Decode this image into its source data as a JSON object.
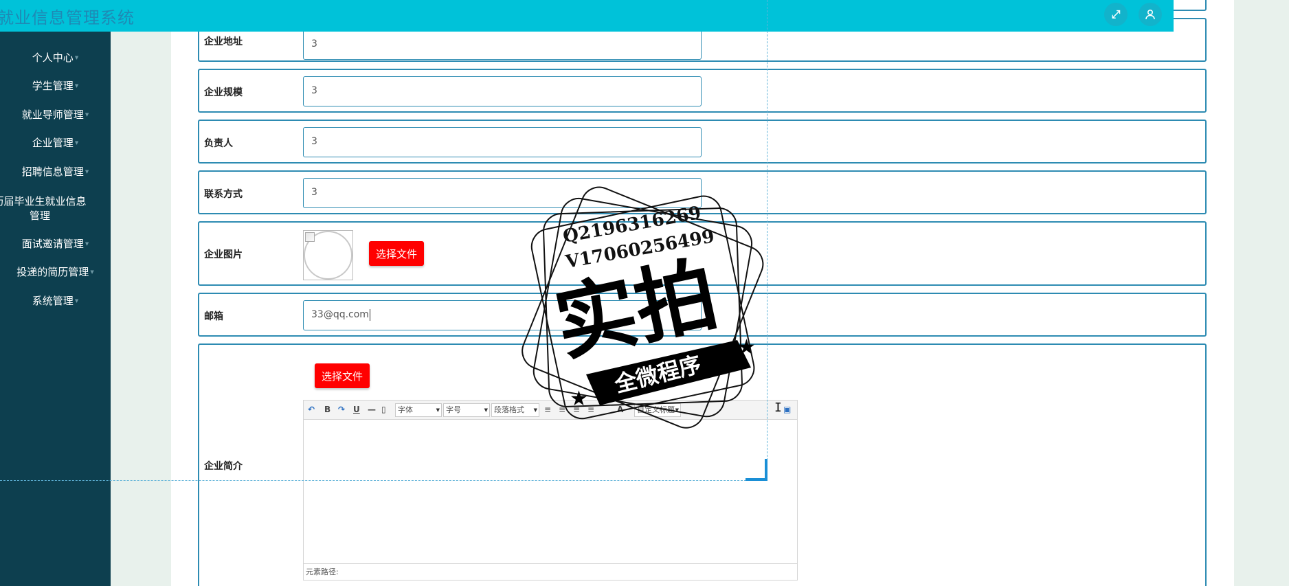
{
  "header": {
    "title": "就业信息管理系统",
    "fullscreen_icon": "expand-icon",
    "user_icon": "user-icon"
  },
  "sidebar": {
    "items": [
      {
        "label": "个人中心"
      },
      {
        "label": "学生管理"
      },
      {
        "label": "就业导师管理"
      },
      {
        "label": "企业管理"
      },
      {
        "label": "招聘信息管理"
      },
      {
        "label": "历届毕业生就业信息管理"
      },
      {
        "label": "面试邀请管理"
      },
      {
        "label": "投递的简历管理"
      },
      {
        "label": "系统管理"
      }
    ]
  },
  "form": {
    "address": {
      "label": "企业地址",
      "value": "3"
    },
    "scale": {
      "label": "企业规模",
      "value": "3"
    },
    "manager": {
      "label": "负责人",
      "value": "3"
    },
    "contact": {
      "label": "联系方式",
      "value": "3"
    },
    "image": {
      "label": "企业图片",
      "button": "选择文件"
    },
    "email": {
      "label": "邮箱",
      "value": "33@qq.com"
    },
    "intro": {
      "label": "企业简介",
      "button": "选择文件",
      "toolbar": {
        "font_family": "字体",
        "font_size": "字号",
        "paragraph": "段落格式",
        "custom_title": "自定义标题",
        "font_color": "A"
      },
      "status": "元素路径:"
    }
  },
  "watermark": {
    "line1": "Q2196316269",
    "line2": "V17060256499",
    "main": "实拍",
    "banner": "全微程序"
  }
}
